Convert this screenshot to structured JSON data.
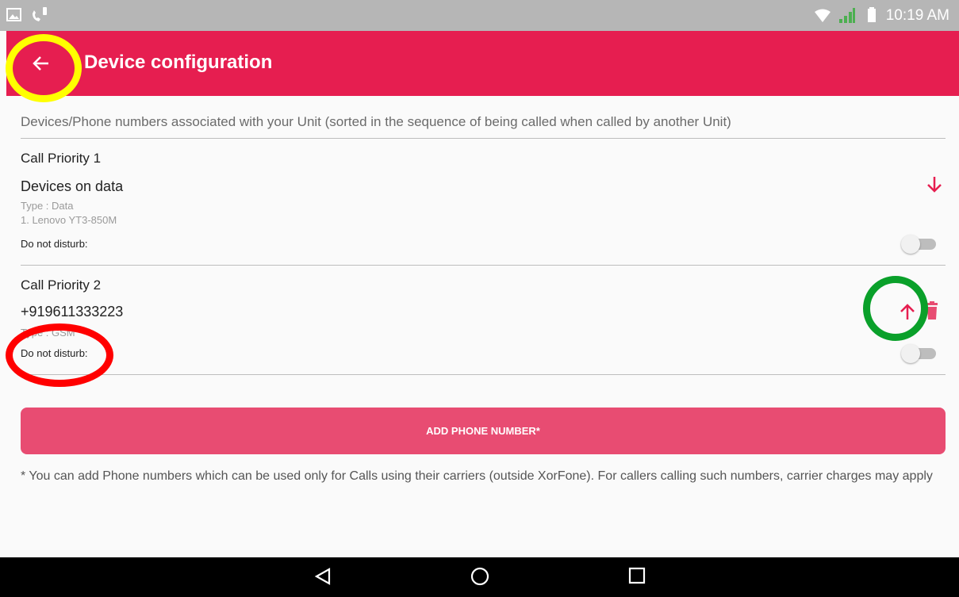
{
  "status_bar": {
    "time": "10:19 AM",
    "icons": [
      "gallery-icon",
      "call-notification-icon",
      "wifi-icon",
      "signal-icon",
      "battery-icon"
    ]
  },
  "app_bar": {
    "title": "Device configuration",
    "back_icon": "arrow-back-icon",
    "color": "#e61e50"
  },
  "intro_text": "Devices/Phone numbers associated with your Unit (sorted in the sequence of being called when called by another Unit)",
  "devices": [
    {
      "priority": "Call Priority 1",
      "name": "Devices on data",
      "type": "Type : Data",
      "detail": "1. Lenovo YT3-850M",
      "dnd_label": "Do not disturb:",
      "dnd_on": false,
      "actions": [
        "arrow-down-icon"
      ]
    },
    {
      "priority": "Call Priority 2",
      "name": "+919611333223",
      "type": "Type : GSM",
      "dnd_label": "Do not disturb:",
      "dnd_on": false,
      "actions": [
        "arrow-up-icon",
        "delete-icon"
      ]
    }
  ],
  "add_button_label": "ADD PHONE NUMBER*",
  "footnote": "* You can add Phone numbers which can be used only for Calls using their carriers (outside XorFone). For callers calling such numbers, carrier charges may apply",
  "nav_bar": [
    "back-triangle-icon",
    "home-circle-icon",
    "recents-square-icon"
  ],
  "annotations": [
    {
      "shape": "circle",
      "color": "#ffff00",
      "target": "back-button"
    },
    {
      "shape": "circle",
      "color": "#0aa02a",
      "target": "move-up-button"
    },
    {
      "shape": "circle",
      "color": "#ff0000",
      "target": "do-not-disturb-label"
    }
  ],
  "accent_color": "#e61e50"
}
